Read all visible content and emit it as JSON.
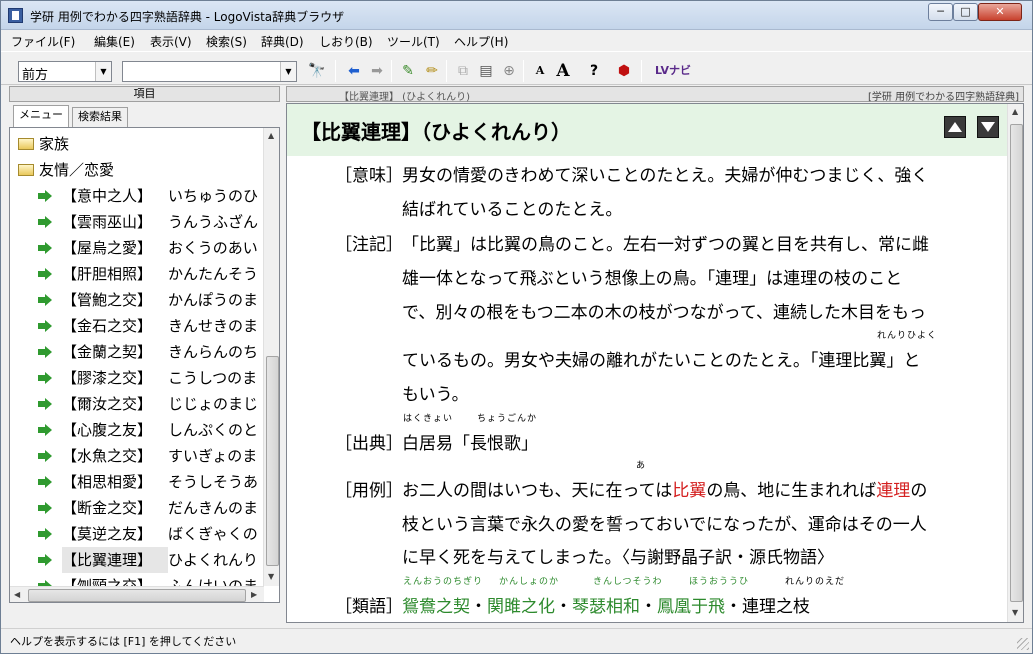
{
  "window": {
    "title": "学研 用例でわかる四字熟語辞典 - LogoVista辞典ブラウザ"
  },
  "menu": [
    "ファイル(F)",
    "編集(E)",
    "表示(V)",
    "検索(S)",
    "辞典(D)",
    "しおり(B)",
    "ツール(T)",
    "ヘルプ(H)"
  ],
  "toolbar": {
    "mode_value": "前方",
    "search_value": ""
  },
  "left_pane": {
    "header": "項目",
    "tabs": [
      "メニュー",
      "検索結果"
    ],
    "folders": [
      "家族",
      "友情／恋愛"
    ],
    "items": [
      {
        "kw": "【意中之人】",
        "reading": "いちゅうのひ"
      },
      {
        "kw": "【雲雨巫山】",
        "reading": "うんうふざん"
      },
      {
        "kw": "【屋烏之愛】",
        "reading": "おくうのあい"
      },
      {
        "kw": "【肝胆相照】",
        "reading": "かんたんそう"
      },
      {
        "kw": "【管鮑之交】",
        "reading": "かんぽうのま"
      },
      {
        "kw": "【金石之交】",
        "reading": "きんせきのま"
      },
      {
        "kw": "【金蘭之契】",
        "reading": "きんらんのち"
      },
      {
        "kw": "【膠漆之交】",
        "reading": "こうしつのま"
      },
      {
        "kw": "【爾汝之交】",
        "reading": "じじょのまじ"
      },
      {
        "kw": "【心腹之友】",
        "reading": "しんぷくのと"
      },
      {
        "kw": "【水魚之交】",
        "reading": "すいぎょのま"
      },
      {
        "kw": "【相思相愛】",
        "reading": "そうしそうあ"
      },
      {
        "kw": "【断金之交】",
        "reading": "だんきんのま"
      },
      {
        "kw": "【莫逆之友】",
        "reading": "ばくぎゃくの"
      },
      {
        "kw": "【比翼連理】",
        "reading": "ひよくれんり"
      },
      {
        "kw": "【刎頸之交】",
        "reading": "ふんけいのま"
      }
    ]
  },
  "right_pane": {
    "breadcrumb": "【比翼連理】 (ひよくれんり)",
    "source": "[学研 用例でわかる四字熟語辞典]",
    "headword": "【比翼連理】（ひよくれんり）",
    "entry": {
      "meaning_label": "［意味］",
      "meaning_lines": [
        "男女の情愛のきわめて深いことのたとえ。夫婦が仲むつまじく、強く",
        "結ばれていることのたとえ。"
      ],
      "note_label": "［注記］",
      "note_lines": [
        "「比翼」は比翼の鳥のこと。左右一対ずつの翼と目を共有し、常に雌",
        "雄一体となって飛ぶという想像上の鳥。「連理」は連理の枝のこと",
        "で、別々の根をもつ二本の木の枝がつながって、連続した木目をもっ",
        "ているもの。男女や夫婦の離れがたいことのたとえ。「連理比翼」と",
        "もいう。"
      ],
      "note_ruby": "れんりひよく",
      "source_label": "［出典］",
      "source_text": "白居易「長恨歌」",
      "source_ruby1": "はくきょい",
      "source_ruby2": "ちょうごんか",
      "usage_label": "［用例］",
      "usage_ruby": "あ",
      "usage_line1_a": "お二人の間はいつも、天に在っては",
      "usage_line1_red1": "比翼",
      "usage_line1_b": "の鳥、地に生まれれば",
      "usage_line1_red2": "連理",
      "usage_line1_c": "の",
      "usage_line2": "枝という言葉で永久の愛を誓っておいでになったが、運命はその一人",
      "usage_line3": "に早く死を与えてしまった。〈与謝野晶子訳・源氏物語〉",
      "syn_label": "［類語］",
      "syn": [
        "鴛鴦之契",
        "関雎之化",
        "琴瑟相和",
        "鳳凰于飛"
      ],
      "syn_last": "連理之枝",
      "syn_sep": "・",
      "syn_ruby": [
        "えんおうのちぎり",
        "かんしょのか",
        "きんしつそうわ",
        "ほうおううひ",
        "れんりのえだ"
      ]
    }
  },
  "status": {
    "text": "ヘルプを表示するには [F1] を押してください"
  },
  "colors": {
    "link": "#2d8a2d",
    "highlight": "#d42020",
    "header_bg": "#e4f4e4"
  }
}
